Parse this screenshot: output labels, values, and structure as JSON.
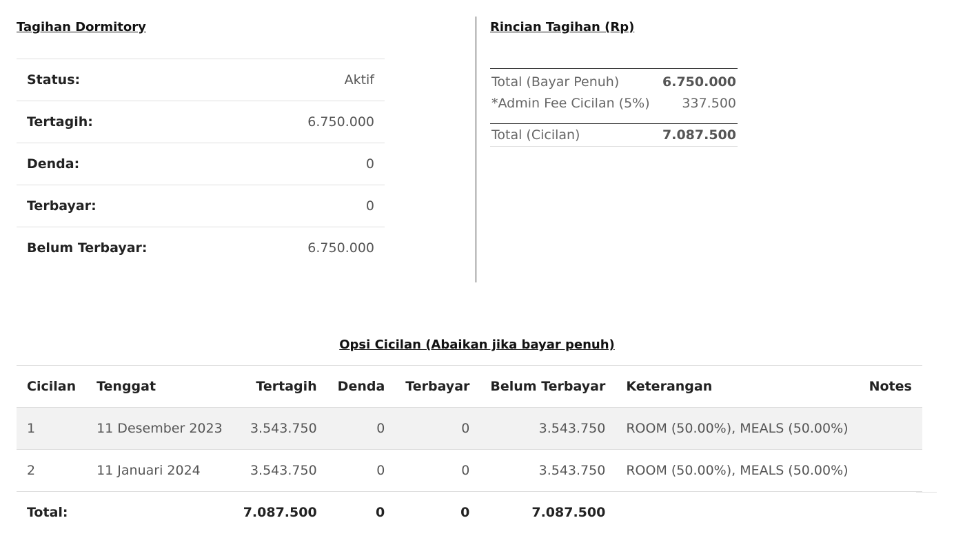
{
  "left": {
    "title": "Tagihan Dormitory",
    "rows": [
      {
        "label": "Status:",
        "value": "Aktif"
      },
      {
        "label": "Tertagih:",
        "value": "6.750.000"
      },
      {
        "label": "Denda:",
        "value": "0"
      },
      {
        "label": "Terbayar:",
        "value": "0"
      },
      {
        "label": "Belum Terbayar:",
        "value": "6.750.000"
      }
    ]
  },
  "right": {
    "title": "Rincian Tagihan (Rp)",
    "rows": [
      {
        "label": "Total (Bayar Penuh)",
        "value": "6.750.000"
      },
      {
        "label": "*Admin Fee Cicilan (5%)",
        "value": "337.500"
      },
      {
        "label": "Total (Cicilan)",
        "value": "7.087.500"
      }
    ]
  },
  "installments": {
    "title": "Opsi Cicilan (Abaikan jika bayar penuh)",
    "headers": [
      "Cicilan",
      "Tenggat",
      "Tertagih",
      "Denda",
      "Terbayar",
      "Belum Terbayar",
      "Keterangan",
      "Notes"
    ],
    "rows": [
      {
        "no": "1",
        "due": "11 Desember 2023",
        "billed": "3.543.750",
        "fine": "0",
        "paid": "0",
        "unpaid": "3.543.750",
        "desc": "ROOM (50.00%), MEALS (50.00%)",
        "notes": ""
      },
      {
        "no": "2",
        "due": "11 Januari 2024",
        "billed": "3.543.750",
        "fine": "0",
        "paid": "0",
        "unpaid": "3.543.750",
        "desc": "ROOM (50.00%), MEALS (50.00%)",
        "notes": ""
      }
    ],
    "total": {
      "label": "Total:",
      "billed": "7.087.500",
      "fine": "0",
      "paid": "0",
      "unpaid": "7.087.500"
    }
  }
}
